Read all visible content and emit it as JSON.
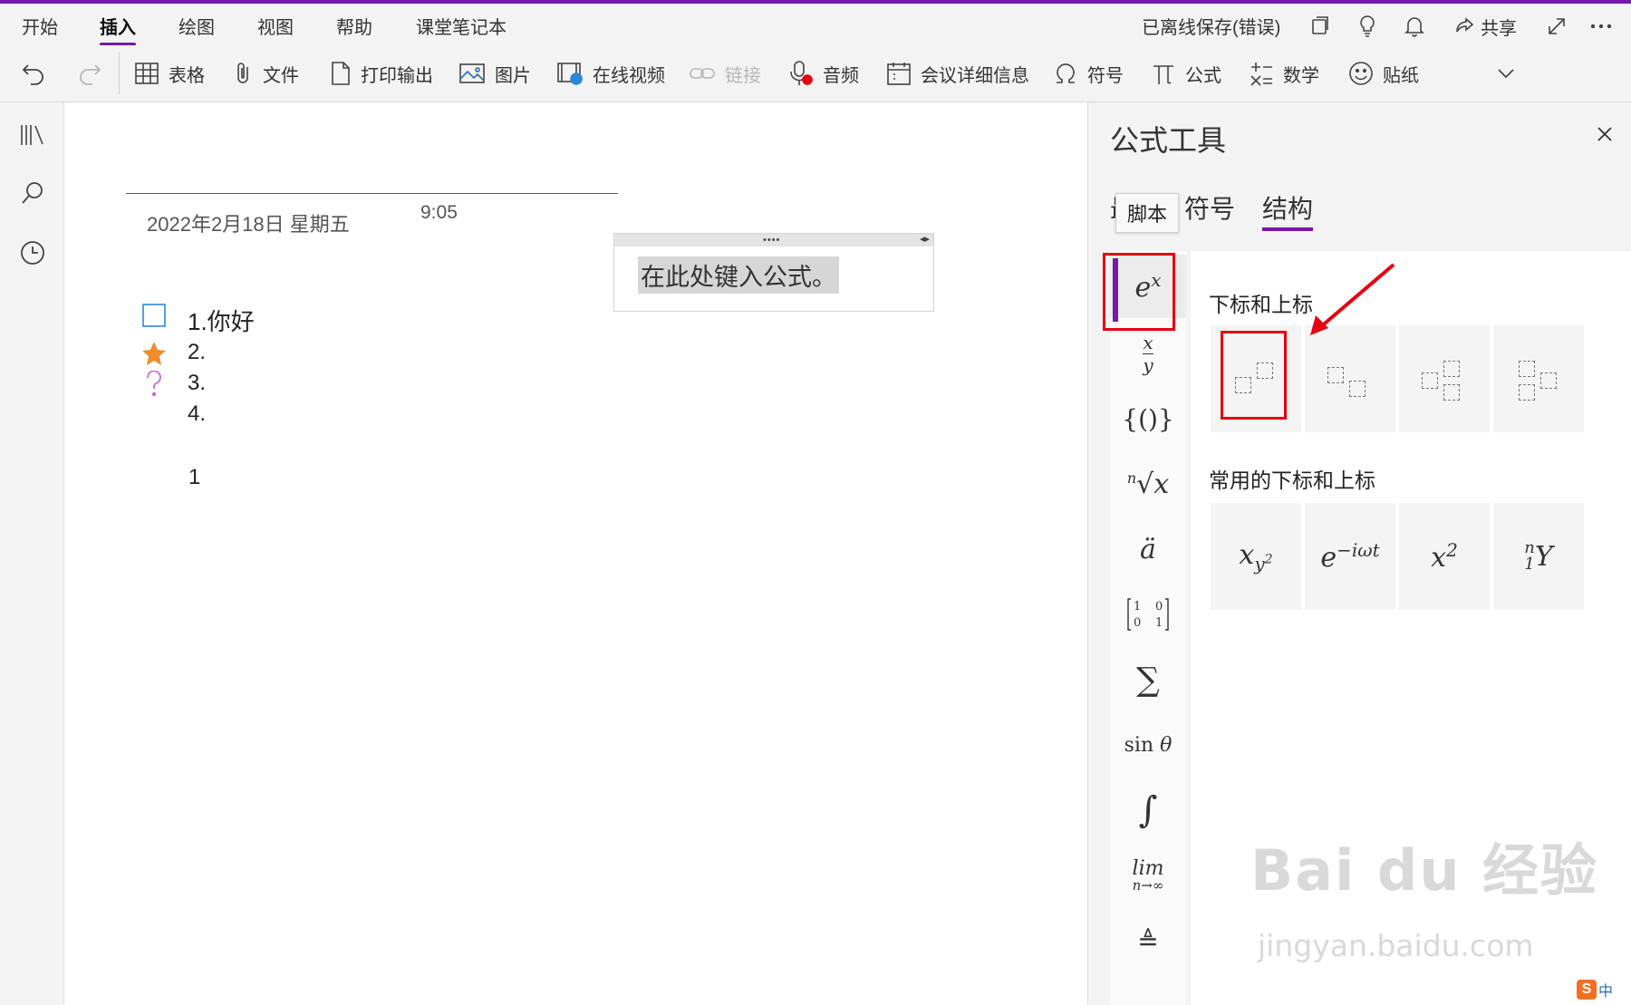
{
  "ribbon": {
    "tabs": [
      "开始",
      "插入",
      "绘图",
      "视图",
      "帮助",
      "课堂笔记本"
    ],
    "active_tab": "插入",
    "save_status": "已离线保存(错误)",
    "share_label": "共享"
  },
  "toolbar": {
    "table": "表格",
    "file": "文件",
    "printout": "打印输出",
    "picture": "图片",
    "online_video": "在线视频",
    "link": "链接",
    "audio": "音频",
    "meeting_details": "会议详细信息",
    "symbol": "符号",
    "equation": "公式",
    "math": "数学",
    "sticker": "贴纸"
  },
  "page": {
    "date": "2022年2月18日 星期五",
    "time": "9:05",
    "equation_placeholder": "在此处键入公式。",
    "list": [
      "1.你好",
      "2.",
      "3.",
      "4."
    ],
    "trailing_text": "1"
  },
  "equation_panel": {
    "title": "公式工具",
    "tabs": [
      "最近",
      "符号",
      "结构"
    ],
    "active_tab": "结构",
    "tooltip": "脚本",
    "categories": {
      "script": "e^x",
      "fraction": "x/y",
      "bracket": "{()}",
      "radical": "ⁿ√x",
      "accent": "ä",
      "matrix": "[1 0; 0 1]",
      "large_operator": "∑",
      "function": "sin θ",
      "integral": "∫",
      "limit": "lim n→∞",
      "operator": "≜"
    },
    "section1_title": "下标和上标",
    "section2_title": "常用的下标和上标",
    "common": [
      "x_{y^2}",
      "e^{−iωt}",
      "x^2",
      "ⁿ₁Y"
    ]
  },
  "watermark": {
    "brand": "Bai du 经验",
    "url": "jingyan.baidu.com"
  },
  "ime_label": "中",
  "colors": {
    "accent": "#7719aa",
    "highlight_red": "#e60012",
    "star": "#f08c2a",
    "question": "#c36bd8",
    "checkbox": "#2b88d8"
  }
}
